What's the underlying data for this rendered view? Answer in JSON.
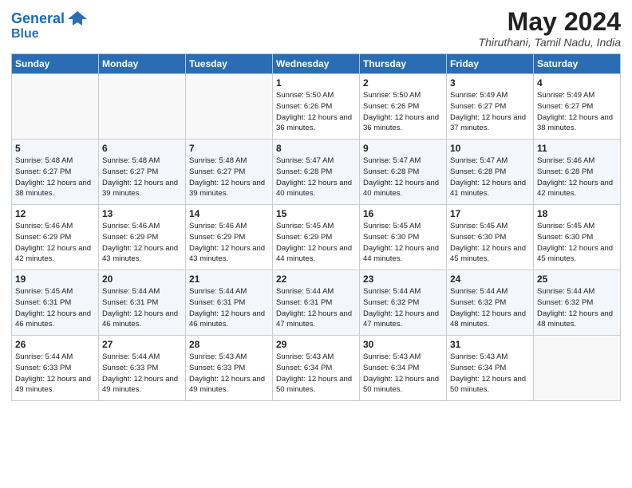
{
  "header": {
    "logo_line1": "General",
    "logo_line2": "Blue",
    "month_title": "May 2024",
    "location": "Thiruthani, Tamil Nadu, India"
  },
  "days_of_week": [
    "Sunday",
    "Monday",
    "Tuesday",
    "Wednesday",
    "Thursday",
    "Friday",
    "Saturday"
  ],
  "weeks": [
    [
      {
        "day": "",
        "info": ""
      },
      {
        "day": "",
        "info": ""
      },
      {
        "day": "",
        "info": ""
      },
      {
        "day": "1",
        "info": "Sunrise: 5:50 AM\nSunset: 6:26 PM\nDaylight: 12 hours\nand 36 minutes."
      },
      {
        "day": "2",
        "info": "Sunrise: 5:50 AM\nSunset: 6:26 PM\nDaylight: 12 hours\nand 36 minutes."
      },
      {
        "day": "3",
        "info": "Sunrise: 5:49 AM\nSunset: 6:27 PM\nDaylight: 12 hours\nand 37 minutes."
      },
      {
        "day": "4",
        "info": "Sunrise: 5:49 AM\nSunset: 6:27 PM\nDaylight: 12 hours\nand 38 minutes."
      }
    ],
    [
      {
        "day": "5",
        "info": "Sunrise: 5:48 AM\nSunset: 6:27 PM\nDaylight: 12 hours\nand 38 minutes."
      },
      {
        "day": "6",
        "info": "Sunrise: 5:48 AM\nSunset: 6:27 PM\nDaylight: 12 hours\nand 39 minutes."
      },
      {
        "day": "7",
        "info": "Sunrise: 5:48 AM\nSunset: 6:27 PM\nDaylight: 12 hours\nand 39 minutes."
      },
      {
        "day": "8",
        "info": "Sunrise: 5:47 AM\nSunset: 6:28 PM\nDaylight: 12 hours\nand 40 minutes."
      },
      {
        "day": "9",
        "info": "Sunrise: 5:47 AM\nSunset: 6:28 PM\nDaylight: 12 hours\nand 40 minutes."
      },
      {
        "day": "10",
        "info": "Sunrise: 5:47 AM\nSunset: 6:28 PM\nDaylight: 12 hours\nand 41 minutes."
      },
      {
        "day": "11",
        "info": "Sunrise: 5:46 AM\nSunset: 6:28 PM\nDaylight: 12 hours\nand 42 minutes."
      }
    ],
    [
      {
        "day": "12",
        "info": "Sunrise: 5:46 AM\nSunset: 6:29 PM\nDaylight: 12 hours\nand 42 minutes."
      },
      {
        "day": "13",
        "info": "Sunrise: 5:46 AM\nSunset: 6:29 PM\nDaylight: 12 hours\nand 43 minutes."
      },
      {
        "day": "14",
        "info": "Sunrise: 5:46 AM\nSunset: 6:29 PM\nDaylight: 12 hours\nand 43 minutes."
      },
      {
        "day": "15",
        "info": "Sunrise: 5:45 AM\nSunset: 6:29 PM\nDaylight: 12 hours\nand 44 minutes."
      },
      {
        "day": "16",
        "info": "Sunrise: 5:45 AM\nSunset: 6:30 PM\nDaylight: 12 hours\nand 44 minutes."
      },
      {
        "day": "17",
        "info": "Sunrise: 5:45 AM\nSunset: 6:30 PM\nDaylight: 12 hours\nand 45 minutes."
      },
      {
        "day": "18",
        "info": "Sunrise: 5:45 AM\nSunset: 6:30 PM\nDaylight: 12 hours\nand 45 minutes."
      }
    ],
    [
      {
        "day": "19",
        "info": "Sunrise: 5:45 AM\nSunset: 6:31 PM\nDaylight: 12 hours\nand 46 minutes."
      },
      {
        "day": "20",
        "info": "Sunrise: 5:44 AM\nSunset: 6:31 PM\nDaylight: 12 hours\nand 46 minutes."
      },
      {
        "day": "21",
        "info": "Sunrise: 5:44 AM\nSunset: 6:31 PM\nDaylight: 12 hours\nand 46 minutes."
      },
      {
        "day": "22",
        "info": "Sunrise: 5:44 AM\nSunset: 6:31 PM\nDaylight: 12 hours\nand 47 minutes."
      },
      {
        "day": "23",
        "info": "Sunrise: 5:44 AM\nSunset: 6:32 PM\nDaylight: 12 hours\nand 47 minutes."
      },
      {
        "day": "24",
        "info": "Sunrise: 5:44 AM\nSunset: 6:32 PM\nDaylight: 12 hours\nand 48 minutes."
      },
      {
        "day": "25",
        "info": "Sunrise: 5:44 AM\nSunset: 6:32 PM\nDaylight: 12 hours\nand 48 minutes."
      }
    ],
    [
      {
        "day": "26",
        "info": "Sunrise: 5:44 AM\nSunset: 6:33 PM\nDaylight: 12 hours\nand 49 minutes."
      },
      {
        "day": "27",
        "info": "Sunrise: 5:44 AM\nSunset: 6:33 PM\nDaylight: 12 hours\nand 49 minutes."
      },
      {
        "day": "28",
        "info": "Sunrise: 5:43 AM\nSunset: 6:33 PM\nDaylight: 12 hours\nand 49 minutes."
      },
      {
        "day": "29",
        "info": "Sunrise: 5:43 AM\nSunset: 6:34 PM\nDaylight: 12 hours\nand 50 minutes."
      },
      {
        "day": "30",
        "info": "Sunrise: 5:43 AM\nSunset: 6:34 PM\nDaylight: 12 hours\nand 50 minutes."
      },
      {
        "day": "31",
        "info": "Sunrise: 5:43 AM\nSunset: 6:34 PM\nDaylight: 12 hours\nand 50 minutes."
      },
      {
        "day": "",
        "info": ""
      }
    ]
  ]
}
